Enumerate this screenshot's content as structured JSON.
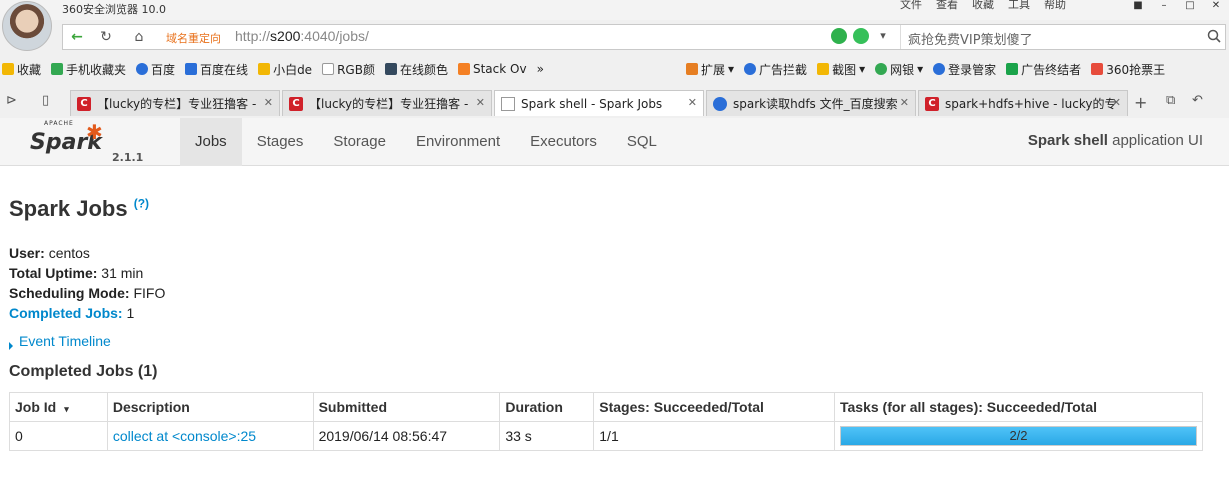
{
  "browser": {
    "app_title": "360安全浏览器 10.0",
    "menu": [
      "文件",
      "查看",
      "收藏",
      "工具",
      "帮助"
    ],
    "redirect_label": "域名重定向",
    "url_prefix": "http://",
    "url_host": "s200",
    "url_rest": ":4040/jobs/",
    "search_placeholder": "疯抢免费VIP策划傻了"
  },
  "bookmarks": [
    {
      "label": "收藏",
      "color": "#f2b705"
    },
    {
      "label": "手机收藏夹",
      "color": "#33a852"
    },
    {
      "label": "百度",
      "color": "#2a6ed8"
    },
    {
      "label": "百度在线",
      "color": "#2a6ed8"
    },
    {
      "label": "小白de",
      "color": "#f2b705"
    },
    {
      "label": "RGB颜",
      "color": "#999999"
    },
    {
      "label": "在线颜色",
      "color": "#34495e"
    },
    {
      "label": "Stack Ov",
      "color": "#f48024"
    }
  ],
  "bookmarks_right": [
    {
      "label": "扩展",
      "color": "#e67e22"
    },
    {
      "label": "广告拦截",
      "color": "#2a6ed8"
    },
    {
      "label": "截图",
      "color": "#f2b705"
    },
    {
      "label": "网银",
      "color": "#33a852"
    },
    {
      "label": "登录管家",
      "color": "#2a6ed8"
    },
    {
      "label": "广告终结者",
      "color": "#1aa34a"
    },
    {
      "label": "360抢票王",
      "color": "#e74c3c"
    }
  ],
  "tabs": [
    {
      "label": "【lucky的专栏】专业狂撸客 -",
      "fav": "c"
    },
    {
      "label": "【lucky的专栏】专业狂撸客 -",
      "fav": "c"
    },
    {
      "label": "Spark shell - Spark Jobs",
      "fav": "doc"
    },
    {
      "label": "spark读取hdfs 文件_百度搜索",
      "fav": "paw"
    },
    {
      "label": "spark+hdfs+hive - lucky的专",
      "fav": "c"
    }
  ],
  "spark": {
    "logo_apache": "APACHE",
    "logo_spark": "Spark",
    "version": "2.1.1",
    "nav": [
      "Jobs",
      "Stages",
      "Storage",
      "Environment",
      "Executors",
      "SQL"
    ],
    "app_name": "Spark shell",
    "app_suffix": " application UI",
    "page_title": "Spark Jobs",
    "help_mark": "(?)",
    "user_label": "User:",
    "user": "centos",
    "uptime_label": "Total Uptime:",
    "uptime": "31 min",
    "mode_label": "Scheduling Mode:",
    "mode": "FIFO",
    "completed_label": "Completed Jobs:",
    "completed_count": "1",
    "event_timeline": "Event Timeline",
    "completed_title": "Completed Jobs (1)",
    "table": {
      "headers": [
        "Job Id",
        "Description",
        "Submitted",
        "Duration",
        "Stages: Succeeded/Total",
        "Tasks (for all stages): Succeeded/Total"
      ],
      "sort_caret": "▾",
      "rows": [
        {
          "job_id": "0",
          "description": "collect at <console>:25",
          "submitted": "2019/06/14 08:56:47",
          "duration": "33 s",
          "stages": "1/1",
          "tasks": "2/2",
          "tasks_fraction": 1.0
        }
      ]
    }
  }
}
